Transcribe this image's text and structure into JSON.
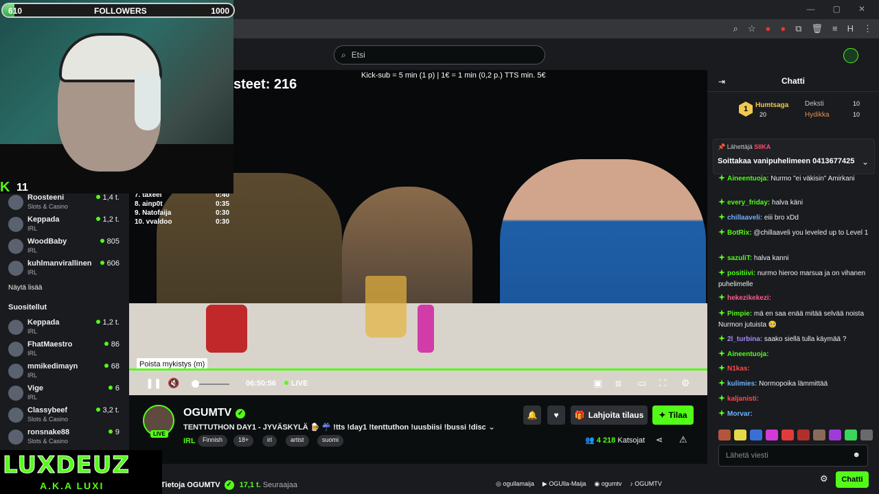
{
  "browser": {
    "window_controls": [
      "—",
      "▢",
      "✕"
    ],
    "toolbar_icons": [
      "⌕",
      "☆",
      "●",
      "●",
      "⧉",
      "🗑",
      "≡",
      "H",
      "⋮"
    ]
  },
  "search": {
    "placeholder": "Etsi"
  },
  "overlay": {
    "followers_min": "610",
    "followers_label": "FOLLOWERS",
    "followers_max": "1000",
    "followers_progress": 0.05,
    "kick_count": "11",
    "sub_info": "Kick-sub = 5 min (1 p) | 1€ = 1 min (0,2 p.) TTS min. 5€",
    "counter_text": "steet: 216",
    "leaderboard": [
      {
        "name": "7. taxeel",
        "time": "0:40"
      },
      {
        "name": "8. ainp0t",
        "time": "0:35"
      },
      {
        "name": "9. Natofaija",
        "time": "0:30"
      },
      {
        "name": "10. vvaldoo",
        "time": "0:30"
      }
    ],
    "brand_main": "LUXDEUZ",
    "brand_sub": "A.K.A LUXI"
  },
  "sidebar": {
    "following": [
      {
        "name": "Roosteeni",
        "category": "Slots & Casino",
        "viewers": "1,4 t."
      },
      {
        "name": "Keppada",
        "category": "IRL",
        "viewers": "1,2 t."
      },
      {
        "name": "WoodBaby",
        "category": "IRL",
        "viewers": "805"
      },
      {
        "name": "kuhlmanvirallinen",
        "category": "IRL",
        "viewers": "606"
      }
    ],
    "show_more": "Näytä lisää",
    "recommended_title": "Suositellut",
    "recommended": [
      {
        "name": "Keppada",
        "category": "IRL",
        "viewers": "1,2 t."
      },
      {
        "name": "FhatMaestro",
        "category": "IRL",
        "viewers": "86"
      },
      {
        "name": "mmikedimayn",
        "category": "IRL",
        "viewers": "68"
      },
      {
        "name": "Vige",
        "category": "IRL",
        "viewers": "6"
      },
      {
        "name": "Classybeef",
        "category": "Slots & Casino",
        "viewers": "3,2 t."
      },
      {
        "name": "ronsnake88",
        "category": "Slots & Casino",
        "viewers": "9"
      }
    ]
  },
  "player": {
    "tooltip": "Poista mykistys (m)",
    "time": "06:50:56",
    "live": "LIVE",
    "progress": 1.0
  },
  "channel": {
    "name": "OGUMTV",
    "live_badge": "LIVE",
    "title": "TENTTUTHON DAY1 - JYVÄSKYLÄ 🍺 ☔ !tts !day1 !tenttuthon !uusbiisi !bussi !discor...",
    "category": "IRL",
    "tags": [
      "Finnish",
      "18+",
      "irl",
      "artist",
      "suomi"
    ],
    "gift_label": "Lahjoita tilaus",
    "subscribe_label": "Tilaa",
    "viewers_count": "4 218",
    "viewers_label": "Katsojat"
  },
  "about": {
    "title": "Tietoja OGUMTV",
    "followers": "17,1 t.",
    "followers_label": "Seuraajaa",
    "socials": [
      "ogullamaija",
      "OGUlla-Maija",
      "ogumtv",
      "OGUMTV"
    ]
  },
  "chat": {
    "title": "Chatti",
    "leaders": [
      {
        "name": "Humtsaga",
        "value": "20",
        "color": "#f2c94c"
      },
      {
        "name": "Deksti",
        "value": "10",
        "color": "#c8c8c8"
      },
      {
        "name": "Hydikka",
        "value": "10",
        "color": "#e3904a"
      }
    ],
    "leader_rank": "1",
    "pinned_by_label": "Lähettäjä",
    "pinned_by_user": "SIIKA",
    "pinned_message": "Soittakaa vanipuhelimeen 0413677425",
    "messages": [
      {
        "user": "Aineentuoja:",
        "text": "Nurmo \"ei väkisin\" Amirkani",
        "color": "#53fc18"
      },
      {
        "user": "every_friday:",
        "text": "halva käni",
        "color": "#53fc18"
      },
      {
        "user": "chillaaveli:",
        "text": "eiii bro xDd",
        "color": "#6fb1ff"
      },
      {
        "user": "BotRix:",
        "text": "@chillaaveli you leveled up to Level 1",
        "color": "#53fc18"
      },
      {
        "user": "sazuliT:",
        "text": "halva kanni",
        "color": "#53fc18"
      },
      {
        "user": "positiivi:",
        "text": "nurmo hieroo marsua ja on vihanen puhelimelle",
        "color": "#53fc18"
      },
      {
        "user": "hekezikekezi:",
        "text": "",
        "color": "#ff5a8a"
      },
      {
        "user": "Pimpie:",
        "text": "mä en saa enää mitää selvää noista Nurmon jutuista 🥺",
        "color": "#53fc18"
      },
      {
        "user": "2l_turbina:",
        "text": "saako siellä tulla käymää ?",
        "color": "#a78bfa"
      },
      {
        "user": "Aineentuoja:",
        "text": "",
        "color": "#53fc18"
      },
      {
        "user": "N1kas:",
        "text": "",
        "color": "#ff4a4a"
      },
      {
        "user": "kulimies:",
        "text": "Normopoika lämmittää",
        "color": "#6fb1ff"
      },
      {
        "user": "kaljanisti:",
        "text": "",
        "color": "#ff4a4a"
      },
      {
        "user": "Morvar:",
        "text": "",
        "color": "#6fb1ff"
      }
    ],
    "input_placeholder": "Lähetä viesti",
    "send_label": "Chatti"
  },
  "colors": {
    "accent": "#53fc18",
    "background": "#0b0e0f",
    "panel": "#191b1f"
  }
}
